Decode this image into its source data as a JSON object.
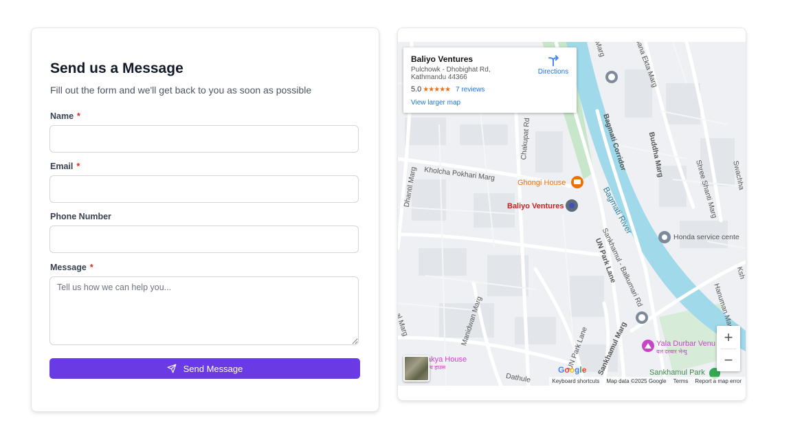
{
  "form": {
    "title": "Send us a Message",
    "subtitle": "Fill out the form and we'll get back to you as soon as possible",
    "name_label": "Name",
    "email_label": "Email",
    "phone_label": "Phone Number",
    "message_label": "Message",
    "required_mark": "*",
    "name_value": "",
    "email_value": "",
    "phone_value": "",
    "message_placeholder": "Tell us how we can help you...",
    "submit_label": "Send Message",
    "submit_color": "#6a3be4"
  },
  "map": {
    "place_name": "Baliyo Ventures",
    "address": "Pulchowk - Dhobighat Rd, Kathmandu 44366",
    "rating": "5.0",
    "stars": "★★★★★",
    "reviews": "7 reviews",
    "directions_label": "Directions",
    "view_larger": "View larger map",
    "zoom_in": "+",
    "zoom_out": "−",
    "google_logo": "Google",
    "keyboard_shortcuts": "Keyboard shortcuts",
    "map_data": "Map data ©2025 Google",
    "terms": "Terms",
    "report_error": "Report a map error",
    "labels": {
      "kholcha": "Kholcha Pokhari Marg",
      "dhantil": "Dhantil Marg",
      "chakupat": "Chakupat Rd",
      "ghongi": "Ghongi House",
      "baliyo": "Baliyo Ventures",
      "bagmati_corridor": "Bagmati Corridor",
      "bagmati_river": "Bagmati River",
      "buddha_marg": "Buddha Marg",
      "shree_shanti": "Shree Shanti Marg",
      "swachha": "Swachha",
      "jana_ekta": "Jana Ekta Marg",
      "honda": "Honda service cente",
      "sankhamul_balkumari": "Sankhamul - Balkumari Rd",
      "un_park_lane": "UN Park Lane",
      "manidwan": "Manidwan Marg",
      "sankhamul_marg": "Sankhamul Marg",
      "un_park_lane_2": "UN Park Lane",
      "yala_durbar": "Yala Durbar Venu",
      "yala_durbar_np": "यल दरबार भेन्यु",
      "sankhamul_park": "Sankhamul Park",
      "hanuman": "Hanuman Marg",
      "dathule": "Dathule",
      "shakya": "akya House",
      "shakya_np": "क्य हाउस",
      "marg_top": "Marg",
      "lal_marg": "al Marg",
      "ksh": "Ksh"
    },
    "colors": {
      "river": "#9fd9ea",
      "park": "#c8e6c9",
      "marker": "#3f51b5",
      "ghongi": "#e8710a",
      "baliyo": "#c5221f",
      "yala": "#c744c7"
    }
  }
}
